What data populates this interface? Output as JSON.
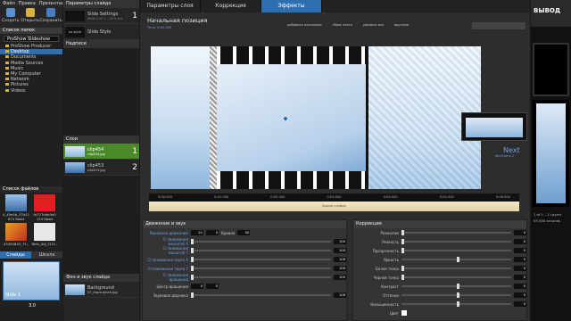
{
  "menu": [
    "Файл",
    "Правка",
    "Презентация"
  ],
  "toolbar": [
    "Создать",
    "Открыть",
    "Сохранить"
  ],
  "left": {
    "folders_title": "Список папок",
    "root_label": "ProShow Slideshow",
    "tree": [
      "ProShow Producer",
      "Desktop",
      "Documents",
      "Media Sources",
      "Music",
      "My Computer",
      "Network",
      "Pictures",
      "Videos"
    ],
    "files_title": "Список файлов",
    "files": [
      {
        "name": "4_49e4b_37a11",
        "meta": "874 Kbait",
        "color": "#3b6fa8"
      },
      {
        "name": "fa727dde4e0",
        "meta": "124 Kbait",
        "color": "#e02020"
      },
      {
        "name": "43454845_7f...",
        "meta": "",
        "color": "#c05a20"
      },
      {
        "name": "Nlits_4dj_f11f...",
        "meta": "",
        "color": "#e8e8e8"
      }
    ],
    "tabs": [
      "Слайды",
      "Шкала"
    ],
    "slide_label": "Slide 1",
    "slide_time": "3.0"
  },
  "col2": {
    "params_title": "Параметры слайда",
    "slide_settings": "Slide Settings",
    "slide_settings_sub": "Slide 1 of 1 – 00.0 sec",
    "slide_style": "Slide Style",
    "no_style": "no style",
    "captions_title": "Надписи",
    "layers_title": "Слои",
    "layers": [
      {
        "name": "clip454",
        "file": "clip454.jpg",
        "num": "1"
      },
      {
        "name": "clip453",
        "file": "clip453.jpg",
        "num": "2"
      }
    ],
    "bg_title": "Фон и звук слайда",
    "bg_name": "Background",
    "bg_file": "07_more-azure.jpg"
  },
  "main": {
    "tabs": [
      "Параметры слоя",
      "Коррекция",
      "Эффекты"
    ],
    "active_tab": 2,
    "position_title": "Начальная позиция",
    "time_label": "Time: 0:00.000",
    "actions": [
      "добавить несколько",
      "сброс всего",
      "удалить все",
      "вручную"
    ],
    "next_label": "Next",
    "next_sub": "KeyFrame 2",
    "time_marks": [
      "0:00.000",
      "0:01.000",
      "0:02.000",
      "0:03.000",
      "0:04.000",
      "0:05.000",
      "0:06.000"
    ],
    "timeline_label": "Время слайда",
    "motion": {
      "title": "Движение и звук",
      "rows": [
        {
          "label": "Линейное движение",
          "a": "21",
          "b": "0"
        },
        {
          "label": "Сглаживания масштаб X",
          "a": "",
          "b": "100"
        },
        {
          "label": "Сглаживания масштаб Y",
          "a": "",
          "b": "100"
        },
        {
          "label": "Сглаживания звука X",
          "a": "",
          "b": "100"
        },
        {
          "label": "Сглаживания звука Y",
          "a": "",
          "b": "100"
        },
        {
          "label": "Сглаживания вращения",
          "a": "",
          "b": "100"
        },
        {
          "label": "Центр вращения",
          "a": "0",
          "b": "0"
        },
        {
          "label": "Звуковая дорожка",
          "a": "",
          "b": "100"
        }
      ],
      "curve_label": "Кривая",
      "curve_value": "50"
    },
    "correction": {
      "title": "Коррекция",
      "rows": [
        {
          "label": "Размытие",
          "value": "0"
        },
        {
          "label": "Резкость",
          "value": "0"
        },
        {
          "label": "Прозрачность",
          "value": "0"
        },
        {
          "label": "Яркость",
          "value": "0"
        },
        {
          "label": "Белая точка",
          "value": "0"
        },
        {
          "label": "Черная точка",
          "value": "0"
        },
        {
          "label": "Контраст",
          "value": "0"
        },
        {
          "label": "Оттенки",
          "value": "0"
        },
        {
          "label": "Насыщенность",
          "value": "0"
        }
      ],
      "color_label": "Цвет"
    }
  },
  "right": {
    "title": "ВЫВОД",
    "info": "1 of 1 – 2 Layers",
    "info2": "03.000 seconds",
    "time": "00:00.00"
  },
  "colors": {
    "accent": "#2f6fb0",
    "green": "#33aa33"
  }
}
